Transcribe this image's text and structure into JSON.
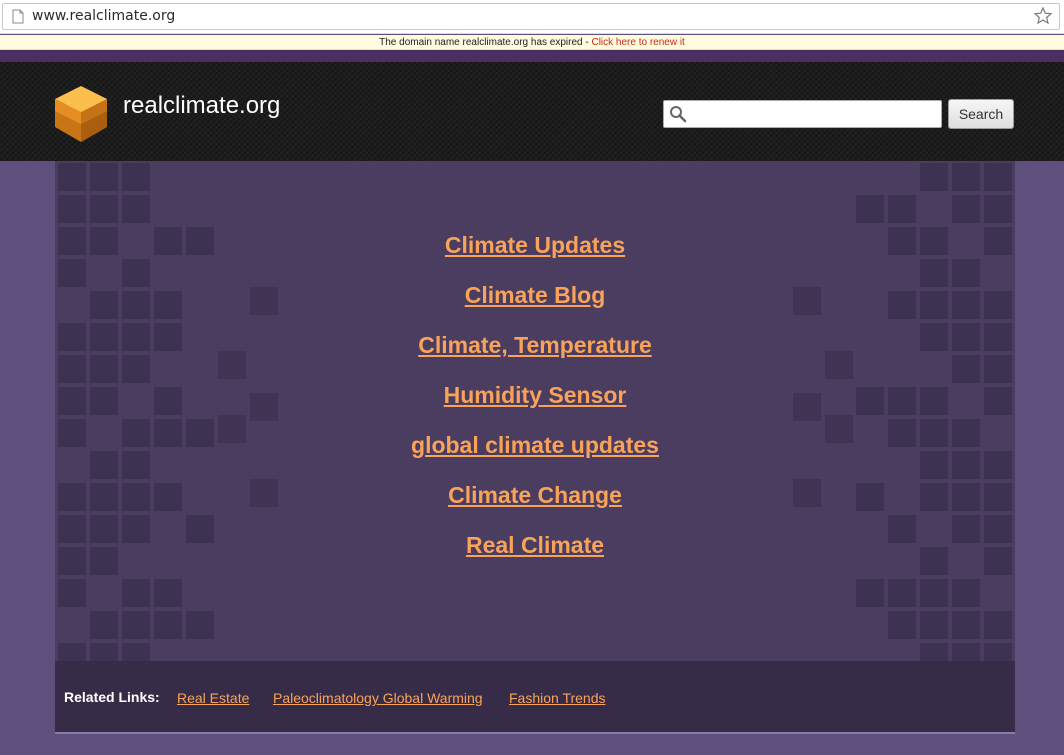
{
  "browser": {
    "url": "www.realclimate.org"
  },
  "notice": {
    "message": "The domain name realclimate.org has expired - ",
    "renew_link": "Click here to renew it"
  },
  "header": {
    "site_name": "realclimate.org",
    "search_value": "",
    "search_button": "Search",
    "logo_color": "#f5a623"
  },
  "main": {
    "links": [
      "Climate Updates",
      "Climate Blog",
      "Climate, Temperature",
      "Humidity Sensor",
      "global climate updates",
      "Climate Change",
      "Real Climate"
    ]
  },
  "footer": {
    "label": "Related Links:",
    "links": [
      "Real Estate",
      "Paleoclimatology Global Warming",
      "Fashion Trends"
    ]
  },
  "colors": {
    "link": "#f9a35a",
    "panel": "#4a3d5f",
    "background": "#5e4f7c",
    "header": "#1d1d1d"
  }
}
